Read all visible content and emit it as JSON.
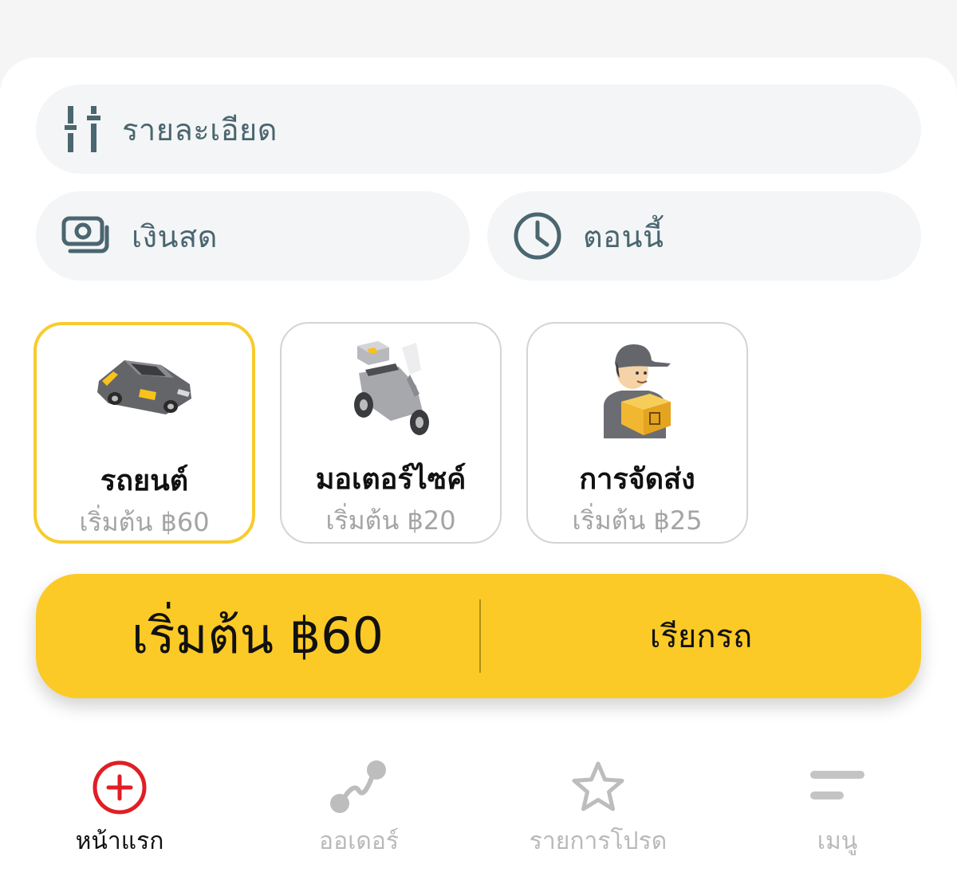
{
  "options": {
    "details_label": "รายละเอียด",
    "payment_label": "เงินสด",
    "time_label": "ตอนนี้"
  },
  "vehicles": [
    {
      "name": "รถยนต์",
      "price": "เริ่มต้น ฿60",
      "selected": true,
      "icon": "taxi-car-icon"
    },
    {
      "name": "มอเตอร์ไซค์",
      "price": "เริ่มต้น ฿20",
      "selected": false,
      "icon": "motorcycle-icon"
    },
    {
      "name": "การจัดส่ง",
      "price": "เริ่มต้น ฿25",
      "selected": false,
      "icon": "delivery-person-icon"
    }
  ],
  "cta": {
    "fare": "เริ่มต้น ฿60",
    "call_label": "เรียกรถ"
  },
  "nav": [
    {
      "label": "หน้าแรก",
      "icon": "plus-circle-icon",
      "active": true
    },
    {
      "label": "ออเดอร์",
      "icon": "route-icon",
      "active": false
    },
    {
      "label": "รายการโปรด",
      "icon": "star-icon",
      "active": false
    },
    {
      "label": "เมนู",
      "icon": "menu-icon",
      "active": false
    }
  ],
  "colors": {
    "accent": "#fcca26",
    "selected_border": "#f8cb2e",
    "icon_teal": "#4a6670",
    "nav_active": "#e01e25"
  }
}
